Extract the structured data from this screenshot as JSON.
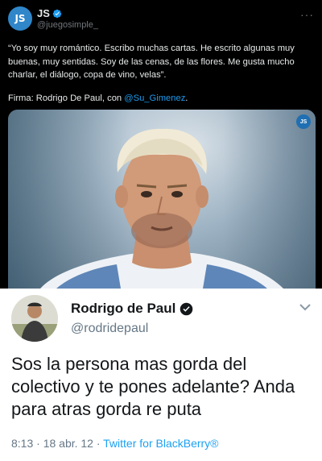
{
  "tweet": {
    "avatar_text": "JS",
    "name": "JS",
    "handle": "@juegosimple_",
    "more_label": "···",
    "text": "“Yo soy muy romántico. Escribo muchas cartas. He escrito algunas muy buenas, muy sentidas. Soy de las cenas, de las flores. Me gusta mucho charlar, el diálogo, copa de vino, velas”.",
    "signature_prefix": "Firma: Rodrigo De Paul, con ",
    "signature_mention": "@Su_Gimenez",
    "signature_suffix": ".",
    "photo_watermark": "JS"
  },
  "quoted": {
    "name": "Rodrigo de Paul",
    "handle": "@rodridepaul",
    "text": "Sos la persona mas gorda del colectivo y te pones adelante? Anda para atras gorda re puta",
    "time": "8:13 · 18 abr. 12 · ",
    "source": "Twitter for BlackBerry®"
  },
  "colors": {
    "accent_dark": "#1d9bf0",
    "accent_light": "#1da1f2",
    "verified": "#1d9bf0"
  },
  "icons": [
    "verified-icon",
    "more-icon",
    "chevron-down-icon"
  ]
}
